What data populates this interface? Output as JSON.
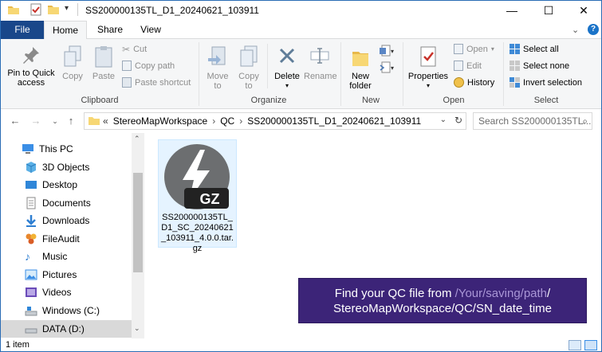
{
  "window": {
    "title": "SS200000135TL_D1_20240621_103911",
    "minimize_label": "—",
    "maximize_label": "☐",
    "close_label": "✕"
  },
  "tabs": [
    {
      "label": "File"
    },
    {
      "label": "Home"
    },
    {
      "label": "Share"
    },
    {
      "label": "View"
    }
  ],
  "ribbon": {
    "clipboard": {
      "pin_label_1": "Pin to Quick",
      "pin_label_2": "access",
      "copy_label": "Copy",
      "paste_label": "Paste",
      "cut_label": "Cut",
      "copy_path_label": "Copy path",
      "paste_shortcut_label": "Paste shortcut",
      "group_label": "Clipboard"
    },
    "organize": {
      "move_to_1": "Move",
      "move_to_2": "to",
      "copy_to_1": "Copy",
      "copy_to_2": "to",
      "delete_label": "Delete",
      "rename_label": "Rename",
      "group_label": "Organize"
    },
    "new": {
      "new_folder_1": "New",
      "new_folder_2": "folder",
      "group_label": "New"
    },
    "open": {
      "properties_label": "Properties",
      "open_label": "Open",
      "edit_label": "Edit",
      "history_label": "History",
      "group_label": "Open"
    },
    "select": {
      "select_all_label": "Select all",
      "select_none_label": "Select none",
      "invert_label": "Invert selection",
      "group_label": "Select"
    }
  },
  "address": {
    "overflow": "«",
    "crumbs": [
      "StereoMapWorkspace",
      "QC",
      "SS200000135TL_D1_20240621_103911"
    ],
    "search_placeholder": "Search SS200000135TL..."
  },
  "nav": {
    "items": [
      {
        "label": "This PC",
        "icon": "pc-icon"
      },
      {
        "label": "3D Objects",
        "icon": "cube-icon"
      },
      {
        "label": "Desktop",
        "icon": "desktop-icon"
      },
      {
        "label": "Documents",
        "icon": "documents-icon"
      },
      {
        "label": "Downloads",
        "icon": "download-icon"
      },
      {
        "label": "FileAudit",
        "icon": "fileaudit-icon"
      },
      {
        "label": "Music",
        "icon": "music-icon"
      },
      {
        "label": "Pictures",
        "icon": "pictures-icon"
      },
      {
        "label": "Videos",
        "icon": "videos-icon"
      },
      {
        "label": "Windows (C:)",
        "icon": "drive-icon"
      },
      {
        "label": "DATA (D:)",
        "icon": "drive-icon"
      }
    ]
  },
  "file": {
    "name": "SS200000135TL_D1_SC_20240621_103911_4.0.0.tar.gz",
    "badge": "GZ"
  },
  "callout": {
    "line1_prefix": "Find your QC file from ",
    "line1_path": "/Your/saving/path",
    "line1_suffix": "/",
    "line2": "StereoMapWorkspace/QC/SN_date_time"
  },
  "status": {
    "item_count": "1 item"
  },
  "colors": {
    "file_tab": "#19478a",
    "callout_bg": "#3c2478",
    "callout_highlight": "#a996d6",
    "selection": "#e5f3ff"
  }
}
